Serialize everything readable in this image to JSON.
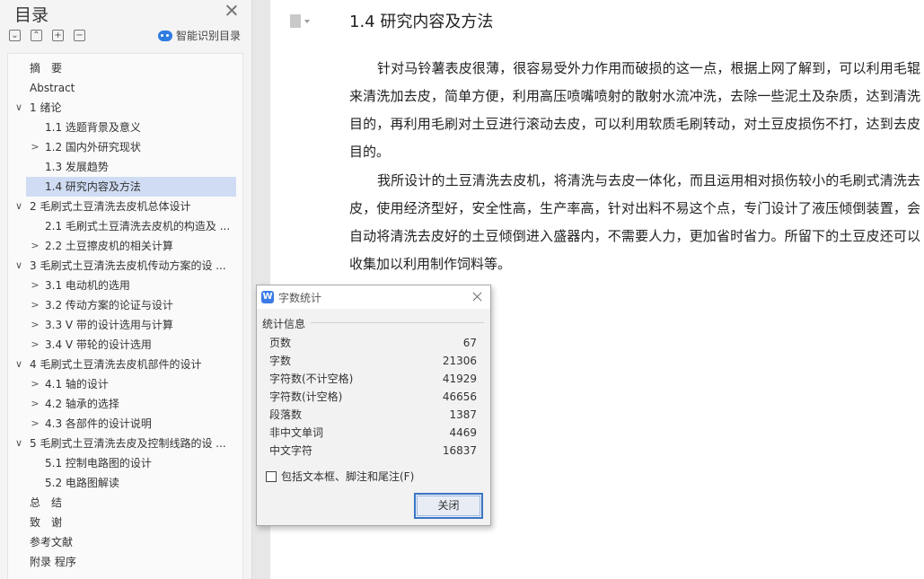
{
  "sidebar": {
    "title": "目录",
    "toolbar": [
      "⌄",
      "⌃",
      "+",
      "−"
    ],
    "smart_label": "智能识别目录",
    "items": [
      {
        "label": "摘　要",
        "arrow": ""
      },
      {
        "label": "Abstract",
        "arrow": ""
      },
      {
        "label": "1 绪论",
        "arrow": "∨"
      },
      {
        "label": "1.1 选题背景及意义",
        "arrow": ""
      },
      {
        "label": "1.2 国内外研究现状",
        "arrow": ">"
      },
      {
        "label": "1.3  发展趋势",
        "arrow": ""
      },
      {
        "label": "1.4 研究内容及方法",
        "arrow": ""
      },
      {
        "label": "2 毛刷式土豆清洗去皮机总体设计",
        "arrow": "∨"
      },
      {
        "label": "2.1 毛刷式土豆清洗去皮机的构造及 ...",
        "arrow": ""
      },
      {
        "label": "2.2  土豆擦皮机的相关计算",
        "arrow": ">"
      },
      {
        "label": "3 毛刷式土豆清洗去皮机传动方案的设 ...",
        "arrow": "∨"
      },
      {
        "label": "3.1 电动机的选用",
        "arrow": ">"
      },
      {
        "label": "3.2 传动方案的论证与设计",
        "arrow": ">"
      },
      {
        "label": "3.3 V 带的设计选用与计算",
        "arrow": ">"
      },
      {
        "label": "3.4 V 带轮的设计选用",
        "arrow": ">"
      },
      {
        "label": "4 毛刷式土豆清洗去皮机部件的设计",
        "arrow": "∨"
      },
      {
        "label": "4.1 轴的设计",
        "arrow": ">"
      },
      {
        "label": "4.2 轴承的选择",
        "arrow": ">"
      },
      {
        "label": "4.3 各部件的设计说明",
        "arrow": ">"
      },
      {
        "label": "5 毛刷式土豆清洗去皮及控制线路的设 ...",
        "arrow": "∨"
      },
      {
        "label": "5.1 控制电路图的设计",
        "arrow": ""
      },
      {
        "label": "5.2 电路图解读",
        "arrow": ""
      },
      {
        "label": "总　结",
        "arrow": ""
      },
      {
        "label": "致　谢",
        "arrow": ""
      },
      {
        "label": "参考文献",
        "arrow": ""
      },
      {
        "label": "附录  程序",
        "arrow": ""
      }
    ]
  },
  "document": {
    "heading": "1.4 研究内容及方法",
    "paragraphs": [
      "针对马铃薯表皮很薄，很容易受外力作用而破损的这一点，根据上网了解到，可以利用毛辊来清洗加去皮，简单方便，利用高压喷嘴喷射的散射水流冲洗，去除一些泥土及杂质，达到清洗目的，再利用毛刷对土豆进行滚动去皮，可以利用软质毛刷转动，对土豆皮损伤不打，达到去皮目的。",
      "我所设计的土豆清洗去皮机，将清洗与去皮一体化，而且运用相对损伤较小的毛刷式清洗去皮，使用经济型好，安全性高，生产率高，针对出料不易这个点，专门设计了液压倾倒装置，会自动将清洗去皮好的土豆倾倒进入盛器内，不需要人力，更加省时省力。所留下的土豆皮还可以收集加以利用制作饲料等。"
    ]
  },
  "dialog": {
    "logo": "W",
    "title": "字数统计",
    "group_title": "统计信息",
    "stats": [
      {
        "label": "页数",
        "value": "67"
      },
      {
        "label": "字数",
        "value": "21306"
      },
      {
        "label": "字符数(不计空格)",
        "value": "41929"
      },
      {
        "label": "字符数(计空格)",
        "value": "46656"
      },
      {
        "label": "段落数",
        "value": "1387"
      },
      {
        "label": "非中文单词",
        "value": "4469"
      },
      {
        "label": "中文字符",
        "value": "16837"
      }
    ],
    "checkbox_label": "包括文本框、脚注和尾注(F)",
    "close_button": "关闭"
  }
}
